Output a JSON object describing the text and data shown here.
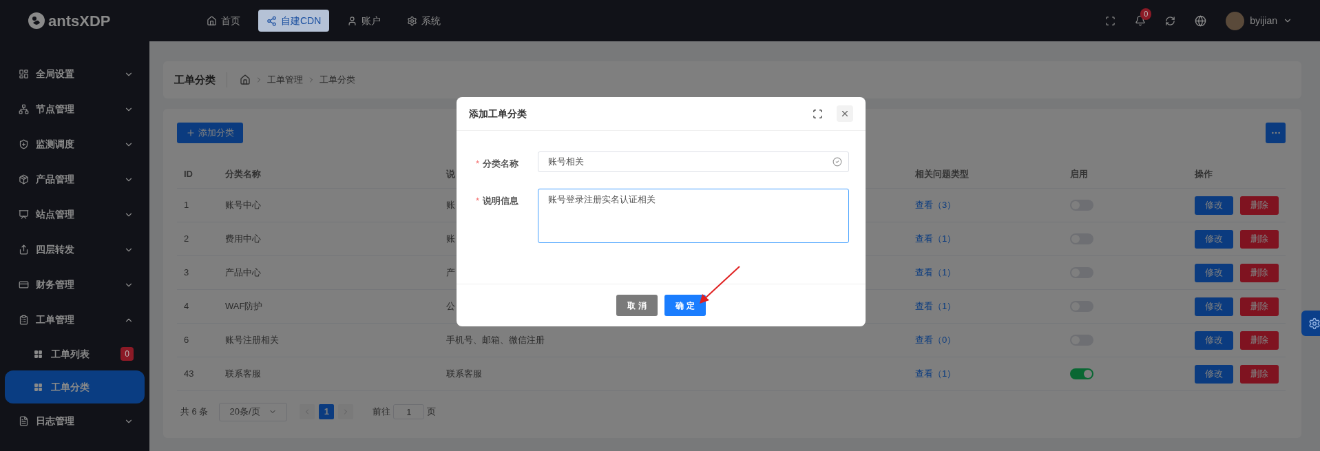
{
  "header": {
    "logo": "antsXDP",
    "nav": [
      {
        "label": "首页",
        "selected": false
      },
      {
        "label": "自建CDN",
        "selected": true
      },
      {
        "label": "账户",
        "selected": false
      },
      {
        "label": "系统",
        "selected": false
      }
    ],
    "notification_count": "0",
    "user": "byijian"
  },
  "sidebar": {
    "items": [
      {
        "label": "全局设置",
        "expanded": false
      },
      {
        "label": "节点管理",
        "expanded": false
      },
      {
        "label": "监测调度",
        "expanded": false
      },
      {
        "label": "产品管理",
        "expanded": false
      },
      {
        "label": "站点管理",
        "expanded": false
      },
      {
        "label": "四层转发",
        "expanded": false
      },
      {
        "label": "财务管理",
        "expanded": false
      },
      {
        "label": "工单管理",
        "expanded": true,
        "children": [
          {
            "label": "工单列表",
            "selected": false,
            "badge": "0"
          },
          {
            "label": "工单分类",
            "selected": true
          }
        ]
      },
      {
        "label": "日志管理",
        "expanded": false
      }
    ]
  },
  "breadcrumb": {
    "title": "工单分类",
    "trail": [
      "工单管理",
      "工单分类"
    ]
  },
  "toolbar": {
    "add_button": "添加分类"
  },
  "table": {
    "columns": [
      "ID",
      "分类名称",
      "说",
      "相关问题类型",
      "启用",
      "操作"
    ],
    "rows": [
      {
        "id": "1",
        "name": "账号中心",
        "description": "账",
        "related": "查看（3）",
        "enabled": false,
        "actions": [
          "修改",
          "删除"
        ]
      },
      {
        "id": "2",
        "name": "费用中心",
        "description": "账",
        "related": "查看（1）",
        "enabled": false,
        "actions": [
          "修改",
          "删除"
        ]
      },
      {
        "id": "3",
        "name": "产品中心",
        "description": "产",
        "related": "查看（1）",
        "enabled": false,
        "actions": [
          "修改",
          "删除"
        ]
      },
      {
        "id": "4",
        "name": "WAF防护",
        "description": "公",
        "related": "查看（1）",
        "enabled": false,
        "actions": [
          "修改",
          "删除"
        ]
      },
      {
        "id": "6",
        "name": "账号注册相关",
        "description": "手机号、邮箱、微信注册",
        "related": "查看（0）",
        "enabled": false,
        "actions": [
          "修改",
          "删除"
        ]
      },
      {
        "id": "43",
        "name": "联系客服",
        "description": "联系客服",
        "related": "查看（1）",
        "enabled": true,
        "actions": [
          "修改",
          "删除"
        ]
      }
    ]
  },
  "pagination": {
    "total": "共 6 条",
    "page_size": "20条/页",
    "pages": [
      {
        "label": "1",
        "selected": true
      }
    ],
    "goto_prefix": "前往",
    "goto_value": "1",
    "goto_suffix": "页"
  },
  "dialog": {
    "title": "添加工单分类",
    "fields": [
      {
        "label": "分类名称",
        "required_mark": "*",
        "kind": "input",
        "value": "账号相关",
        "focused": false,
        "valid": true
      },
      {
        "label": "说明信息",
        "required_mark": "*",
        "kind": "textarea",
        "value": "账号登录注册实名认证相关",
        "focused": true,
        "valid": false
      }
    ],
    "buttons": [
      {
        "label": "取 消",
        "kind": "cancel"
      },
      {
        "label": "确 定",
        "kind": "confirm"
      }
    ]
  }
}
